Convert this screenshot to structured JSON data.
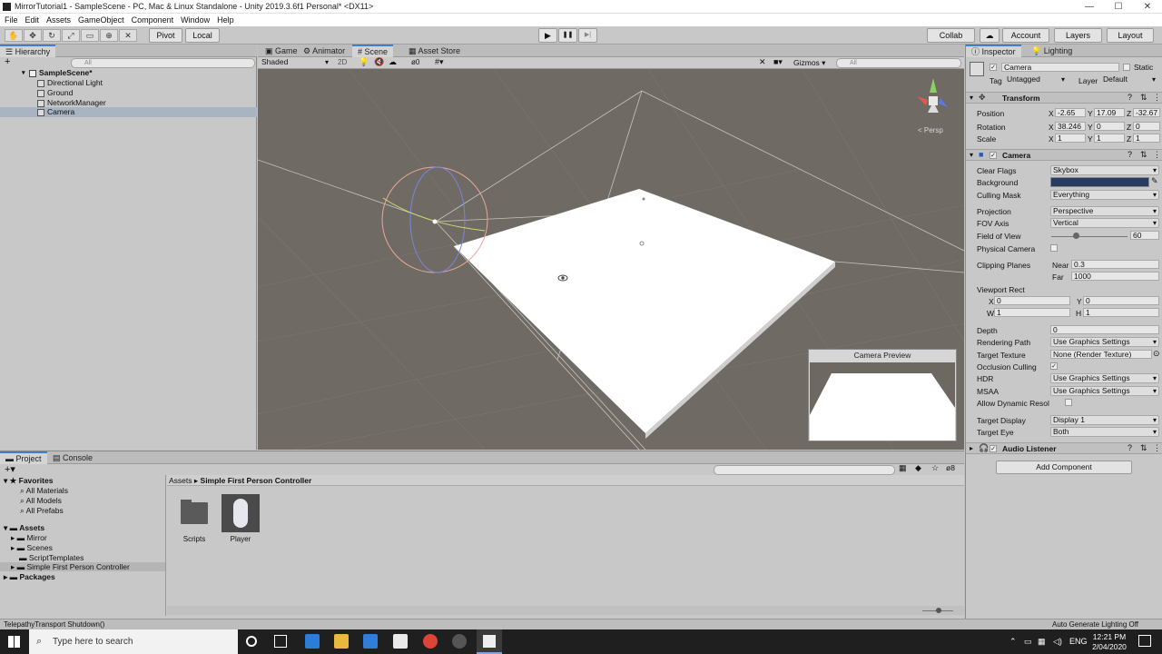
{
  "window": {
    "title": "MirrorTutorial1 - SampleScene - PC, Mac & Linux Standalone - Unity 2019.3.6f1 Personal* <DX11>",
    "min": "—",
    "max": "☐",
    "close": "✕"
  },
  "menu": [
    "File",
    "Edit",
    "Assets",
    "GameObject",
    "Component",
    "Window",
    "Help"
  ],
  "toolbar": {
    "pivot": "Pivot",
    "local": "Local",
    "play": "▶",
    "pause": "❚❚",
    "step": "▶|",
    "collab": "Collab",
    "account": "Account",
    "layers": "Layers",
    "layout": "Layout"
  },
  "hierarchy": {
    "tab": "Hierarchy",
    "add": "+",
    "search_placeholder": "All",
    "scene": "SampleScene*",
    "items": [
      "Directional Light",
      "Ground",
      "NetworkManager",
      "Camera"
    ]
  },
  "scene_tabs": [
    "Game",
    "Animator",
    "Scene",
    "Asset Store"
  ],
  "scene_toolbar": {
    "shading": "Shaded",
    "mode2d": "2D",
    "fx_count": "0",
    "gizmos": "Gizmos",
    "search_placeholder": "All",
    "persp": "< Persp"
  },
  "camera_preview": {
    "title": "Camera Preview"
  },
  "inspector": {
    "tabs": [
      "Inspector",
      "Lighting"
    ],
    "object_name": "Camera",
    "static": "Static",
    "tag_label": "Tag",
    "tag": "Untagged",
    "layer_label": "Layer",
    "layer": "Default",
    "transform": {
      "title": "Transform",
      "position_label": "Position",
      "position": {
        "x": "-2.65",
        "y": "17.09",
        "z": "-32.67"
      },
      "rotation_label": "Rotation",
      "rotation": {
        "x": "38.246",
        "y": "0",
        "z": "0"
      },
      "scale_label": "Scale",
      "scale": {
        "x": "1",
        "y": "1",
        "z": "1"
      }
    },
    "camera": {
      "title": "Camera",
      "clear_flags_label": "Clear Flags",
      "clear_flags": "Skybox",
      "background_label": "Background",
      "background_color": "#283a5e",
      "culling_mask_label": "Culling Mask",
      "culling_mask": "Everything",
      "projection_label": "Projection",
      "projection": "Perspective",
      "fov_axis_label": "FOV Axis",
      "fov_axis": "Vertical",
      "fov_label": "Field of View",
      "fov": "60",
      "physical_label": "Physical Camera",
      "clipping_label": "Clipping Planes",
      "near_label": "Near",
      "near": "0.3",
      "far_label": "Far",
      "far": "1000",
      "viewport_label": "Viewport Rect",
      "vx": "0",
      "vy": "0",
      "vw": "1",
      "vh": "1",
      "depth_label": "Depth",
      "depth": "0",
      "rendering_path_label": "Rendering Path",
      "rendering_path": "Use Graphics Settings",
      "target_texture_label": "Target Texture",
      "target_texture": "None (Render Texture)",
      "occlusion_label": "Occlusion Culling",
      "hdr_label": "HDR",
      "hdr": "Use Graphics Settings",
      "msaa_label": "MSAA",
      "msaa": "Use Graphics Settings",
      "dynres_label": "Allow Dynamic Resol",
      "target_display_label": "Target Display",
      "target_display": "Display 1",
      "target_eye_label": "Target Eye",
      "target_eye": "Both"
    },
    "audio_listener": "Audio Listener",
    "add_component": "Add Component"
  },
  "project": {
    "tabs": [
      "Project",
      "Console"
    ],
    "favorites": "Favorites",
    "fav_items": [
      "All Materials",
      "All Models",
      "All Prefabs"
    ],
    "assets": "Assets",
    "asset_items": [
      "Mirror",
      "Scenes",
      "ScriptTemplates",
      "Simple First Person Controller"
    ],
    "packages": "Packages",
    "breadcrumb": [
      "Assets",
      "Simple First Person Controller"
    ],
    "files": [
      "Scripts",
      "Player"
    ],
    "count": "8"
  },
  "status": {
    "left": "TelepathyTransport Shutdown()",
    "right": "Auto Generate Lighting Off"
  },
  "taskbar": {
    "search_placeholder": "Type here to search",
    "lang": "ENG",
    "time": "12:21 PM",
    "date": "2/04/2020"
  }
}
